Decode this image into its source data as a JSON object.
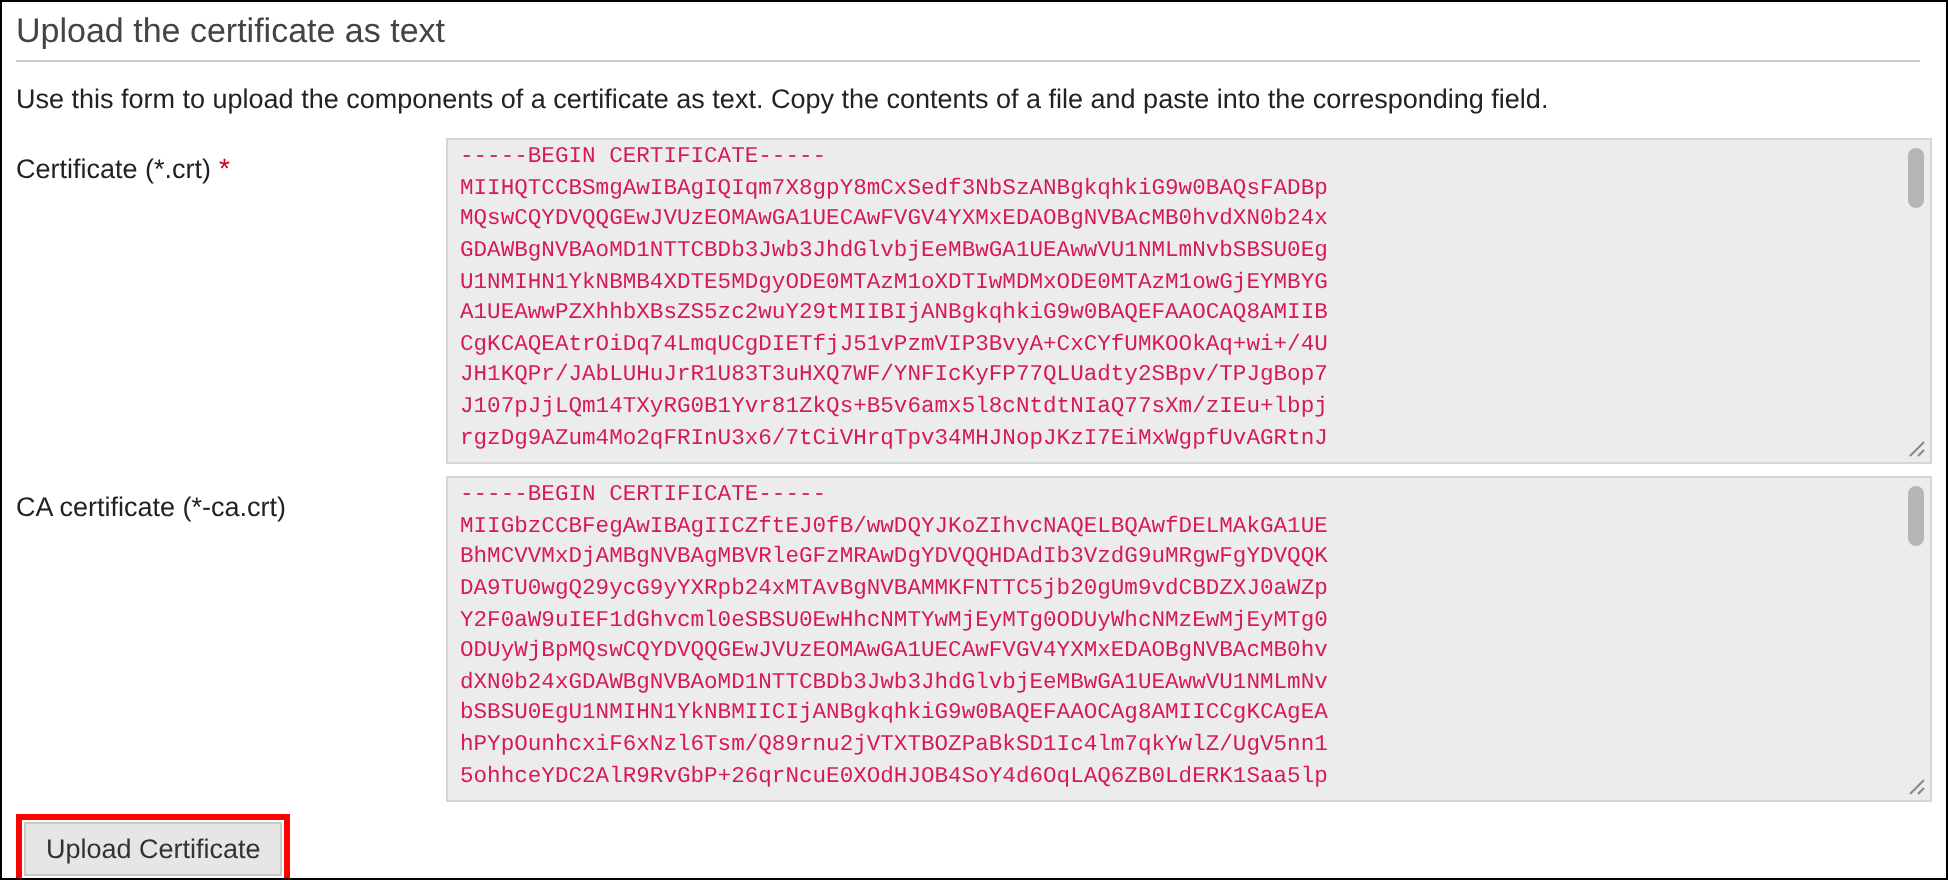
{
  "section": {
    "title": "Upload the certificate as text",
    "description": "Use this form to upload the components of a certificate as text. Copy the contents of a file and paste into the corresponding field."
  },
  "fields": [
    {
      "label": "Certificate (*.crt)",
      "required_mark": "*",
      "value": "-----BEGIN CERTIFICATE-----\nMIIHQTCCBSmgAwIBAgIQIqm7X8gpY8mCxSedf3NbSzANBgkqhkiG9w0BAQsFADBp\nMQswCQYDVQQGEwJVUzEOMAwGA1UECAwFVGV4YXMxEDAOBgNVBAcMB0hvdXN0b24x\nGDAWBgNVBAoMD1NTTCBDb3Jwb3JhdGlvbjEeMBwGA1UEAwwVU1NMLmNvbSBSU0Eg\nU1NMIHN1YkNBMB4XDTE5MDgyODE0MTAzM1oXDTIwMDMxODE0MTAzM1owGjEYMBYG\nA1UEAwwPZXhhbXBsZS5zc2wuY29tMIIBIjANBgkqhkiG9w0BAQEFAAOCAQ8AMIIB\nCgKCAQEAtrOiDq74LmqUCgDIETfjJ51vPzmVIP3BvyA+CxCYfUMKOOkAq+wi+/4U\nJH1KQPr/JAbLUHuJrR1U83T3uHXQ7WF/YNFIcKyFP77QLUadty2SBpv/TPJgBop7\nJ107pJjLQm14TXyRG0B1Yvr81ZkQs+B5v6amx5l8cNtdtNIaQ77sXm/zIEu+lbpj\nrgzDg9AZum4Mo2qFRInU3x6/7tCiVHrqTpv34MHJNopJKzI7EiMxWgpfUvAGRtnJ"
    },
    {
      "label": "CA certificate (*-ca.crt)",
      "value": "-----BEGIN CERTIFICATE-----\nMIIGbzCCBFegAwIBAgIICZftEJ0fB/wwDQYJKoZIhvcNAQELBQAwfDELMAkGA1UE\nBhMCVVMxDjAMBgNVBAgMBVRleGFzMRAwDgYDVQQHDAdIb3VzdG9uMRgwFgYDVQQK\nDA9TU0wgQ29ycG9yYXRpb24xMTAvBgNVBAMMKFNTTC5jb20gUm9vdCBDZXJ0aWZp\nY2F0aW9uIEF1dGhvcml0eSBSU0EwHhcNMTYwMjEyMTg0ODUyWhcNMzEwMjEyMTg0\nODUyWjBpMQswCQYDVQQGEwJVUzEOMAwGA1UECAwFVGV4YXMxEDAOBgNVBAcMB0hv\ndXN0b24xGDAWBgNVBAoMD1NTTCBDb3Jwb3JhdGlvbjEeMBwGA1UEAwwVU1NMLmNv\nbSBSU0EgU1NMIHN1YkNBMIICIjANBgkqhkiG9w0BAQEFAAOCAg8AMIICCgKCAgEA\nhPYpOunhcxiF6xNzl6Tsm/Q89rnu2jVTXTBOZPaBkSD1Ic4lm7qkYwlZ/UgV5nn1\n5ohhceYDC2AlR9RvGbP+26qrNcuE0XOdHJOB4SoY4d6OqLAQ6ZB0LdERK1Saa5lp"
    }
  ],
  "button": {
    "label": "Upload Certificate",
    "highlighted": true
  }
}
